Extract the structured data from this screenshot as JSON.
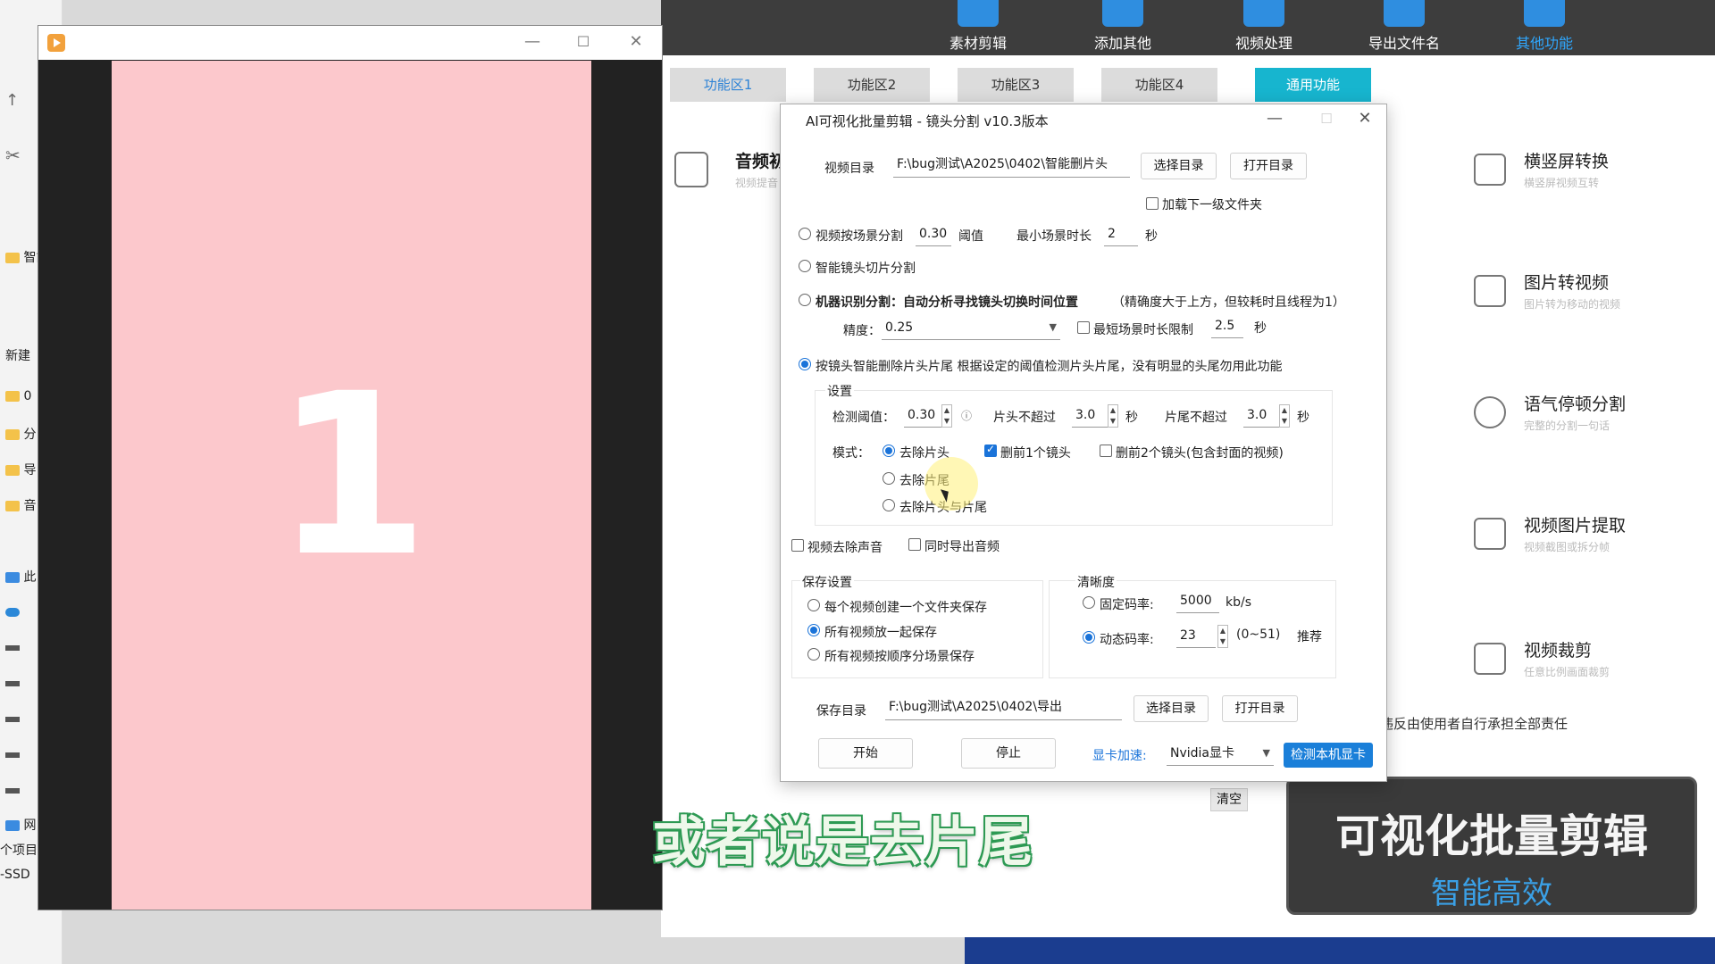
{
  "explorer": {
    "items": [
      "智能",
      "新建",
      "0",
      "分",
      "导",
      "音",
      "此",
      "网",
      "个项目",
      "-SSD"
    ]
  },
  "toolbar": {
    "items": [
      "素材剪辑",
      "添加其他",
      "视频处理",
      "导出文件名",
      "其他功能"
    ]
  },
  "tabs": [
    "功能区1",
    "功能区2",
    "功能区3",
    "功能区4",
    "通用功能"
  ],
  "audio_card": {
    "title": "音频初",
    "subtitle": "视频提音"
  },
  "features": [
    {
      "title": "横竖屏转换",
      "subtitle": "横竖屏视频互转"
    },
    {
      "title": "图片转视频",
      "subtitle": "图片转为移动的视频"
    },
    {
      "title": "语气停顿分割",
      "subtitle": "完整的分割一句话"
    },
    {
      "title": "视频图片提取",
      "subtitle": "视频截图或拆分帧"
    },
    {
      "title": "视频裁剪",
      "subtitle": "任意比例画面裁剪"
    }
  ],
  "disclaimer": "违反由使用者自行承担全部责任",
  "clear_button": "清空",
  "promo": {
    "title": "可视化批量剪辑",
    "subtitle": "智能高效"
  },
  "player": {
    "frame_number": "1",
    "controls": {
      "minimize": "—",
      "maximize": "☐",
      "close": "✕"
    }
  },
  "dialog": {
    "title": "AI可视化批量剪辑 - 镜头分割 v10.3版本",
    "controls": {
      "minimize": "—",
      "maximize": "☐",
      "close": "✕"
    },
    "video_dir": {
      "label": "视频目录",
      "value": "F:\\bug测试\\A2025\\0402\\智能删片头",
      "select": "选择目录",
      "open": "打开目录"
    },
    "load_subfolder": "加载下一级文件夹",
    "scene_split": {
      "label": "视频按场景分割",
      "threshold": "0.30",
      "threshold_label": "阈值",
      "min_label": "最小场景时长",
      "min_value": "2",
      "unit": "秒"
    },
    "smart_split": "智能镜头切片分割",
    "machine_split": {
      "label": "机器识别分割：自动分析寻找镜头切换时间位置",
      "note": "（精确度大于上方，但较耗时且线程为1）"
    },
    "precision": {
      "label": "精度：",
      "value": "0.25",
      "limit_label": "最短场景时长限制",
      "limit_value": "2.5",
      "unit": "秒"
    },
    "head_tail": {
      "label": "按镜头智能删除片头片尾 根据设定的阈值检测片头片尾，没有明显的头尾勿用此功能"
    },
    "settings": {
      "title": "设置",
      "threshold_label": "检测阈值：",
      "threshold_value": "0.30",
      "head_label": "片头不超过",
      "head_value": "3.0",
      "tail_label": "片尾不超过",
      "tail_value": "3.0",
      "unit": "秒",
      "mode_label": "模式：",
      "modes": [
        "去除片头",
        "去除片尾",
        "去除片头与片尾"
      ],
      "delete1": "删前1个镜头",
      "delete2": "删前2个镜头(包含封面的视频)"
    },
    "remove_audio": "视频去除声音",
    "export_audio": "同时导出音频",
    "save_settings": {
      "title": "保存设置",
      "options": [
        "每个视频创建一个文件夹保存",
        "所有视频放一起保存",
        "所有视频按顺序分场景保存"
      ]
    },
    "quality": {
      "title": "清晰度",
      "fixed_label": "固定码率:",
      "fixed_value": "5000",
      "fixed_unit": "kb/s",
      "dynamic_label": "动态码率:",
      "dynamic_value": "23",
      "dynamic_range": "(0~51)",
      "recommend": "推荐"
    },
    "save_dir": {
      "label": "保存目录",
      "value": "F:\\bug测试\\A2025\\0402\\导出",
      "select": "选择目录",
      "open": "打开目录"
    },
    "start": "开始",
    "stop": "停止",
    "gpu": {
      "label": "显卡加速:",
      "value": "Nvidia显卡",
      "detect": "检测本机显卡"
    }
  },
  "subtitle": "或者说是去片尾"
}
